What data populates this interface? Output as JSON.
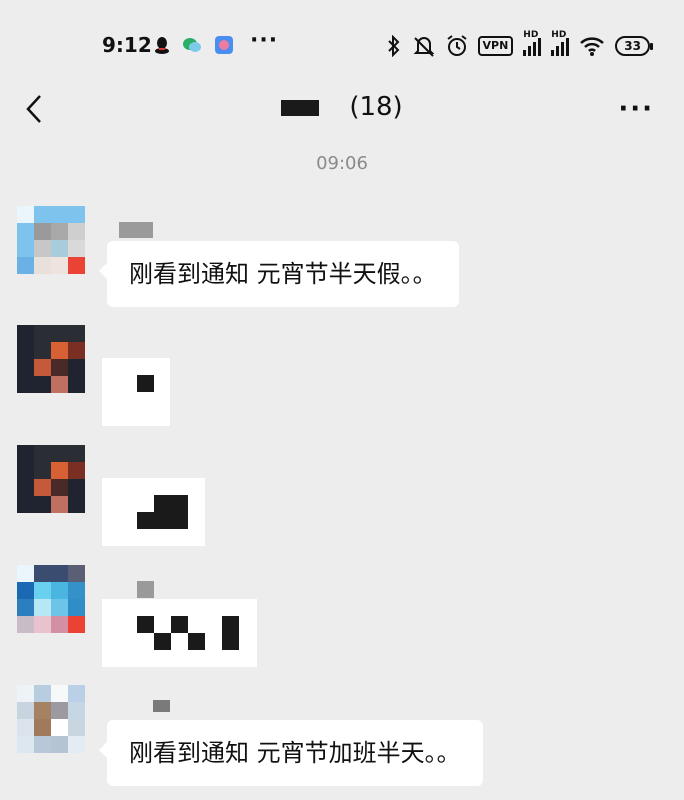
{
  "status_bar": {
    "time": "9:12",
    "more": "···",
    "vpn_label": "VPN",
    "hd_label": "HD",
    "battery": "33"
  },
  "nav": {
    "title_count": "(18)",
    "more": "···"
  },
  "chat": {
    "timestamp": "09:06",
    "messages": [
      {
        "text": "刚看到通知 元宵节半天假。。"
      },
      {
        "text": ""
      },
      {
        "text": ""
      },
      {
        "text": ""
      },
      {
        "text": "刚看到通知 元宵节加班半天。。"
      }
    ]
  },
  "colors": {
    "background": "#ededed",
    "bubble": "#ffffff",
    "timestamp": "#8a8a8a"
  }
}
